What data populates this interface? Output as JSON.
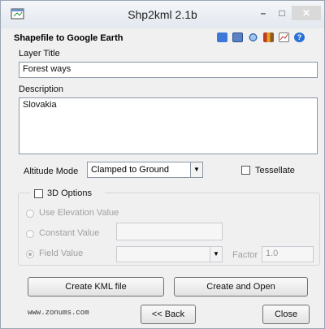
{
  "window": {
    "title": "Shp2kml 2.1b",
    "minimize": "–",
    "maximize": "□",
    "close": "✕"
  },
  "header": {
    "subtitle": "Shapefile to Google Earth"
  },
  "toolbar": {
    "icons": [
      "view-icon",
      "grid-icon",
      "globe-search-icon",
      "library-icon",
      "chart-icon",
      "help-icon"
    ]
  },
  "layer": {
    "label": "Layer Title",
    "value": "Forest ways"
  },
  "description": {
    "label": "Description",
    "value": "Slovakia"
  },
  "altitude": {
    "label": "Altitude Mode",
    "value": "Clamped to Ground"
  },
  "tessellate": {
    "label": "Tessellate",
    "checked": false
  },
  "options3d": {
    "label": "3D Options",
    "checked": false,
    "use_elevation": "Use Elevation Value",
    "constant": "Constant Value",
    "field": "Field Value",
    "factor_label": "Factor",
    "factor_value": "1.0"
  },
  "buttons": {
    "create_kml": "Create KML file",
    "create_open": "Create and Open",
    "back": "<< Back",
    "close": "Close"
  },
  "footer": {
    "url": "www.zonums.com"
  },
  "colors": {
    "titlebar": "#e3e8ef",
    "close_button": "#d9d9d9",
    "accent": "#2a6fd6"
  }
}
